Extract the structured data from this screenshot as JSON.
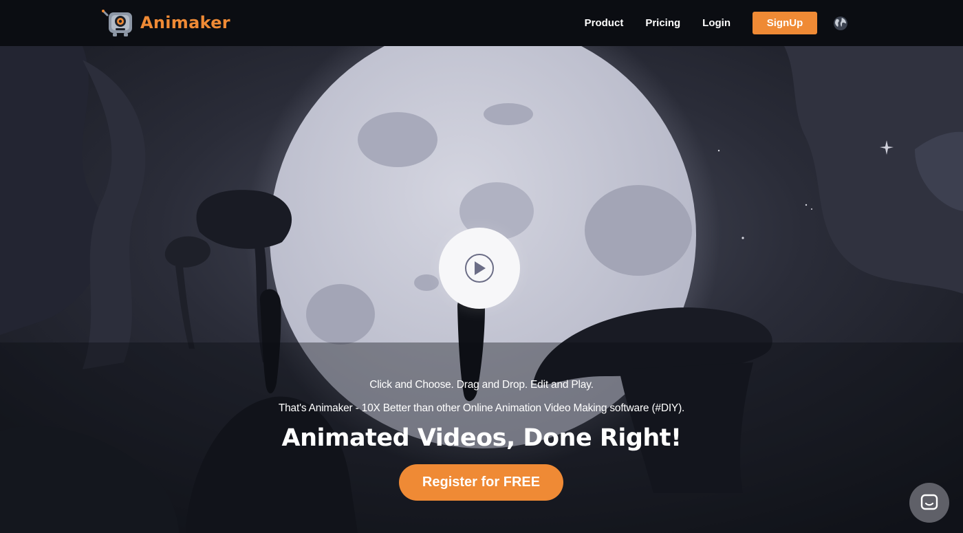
{
  "brand": {
    "name": "Animaker",
    "logo_icon": "robot-mascot-icon",
    "accent_color": "#ef8a35"
  },
  "nav": {
    "links": [
      "Product",
      "Pricing",
      "Login"
    ],
    "signup_label": "SignUp",
    "language_icon": "globe-icon"
  },
  "hero": {
    "play_icon": "play-icon",
    "tagline": "Click and Choose. Drag and Drop. Edit and Play.",
    "subline": "That's Animaker - 10X Better than other Online Animation Video Making software (#DIY).",
    "headline": "Animated Videos, Done Right!",
    "cta_label": "Register for FREE"
  },
  "chat": {
    "icon": "chat-bubble-icon"
  }
}
